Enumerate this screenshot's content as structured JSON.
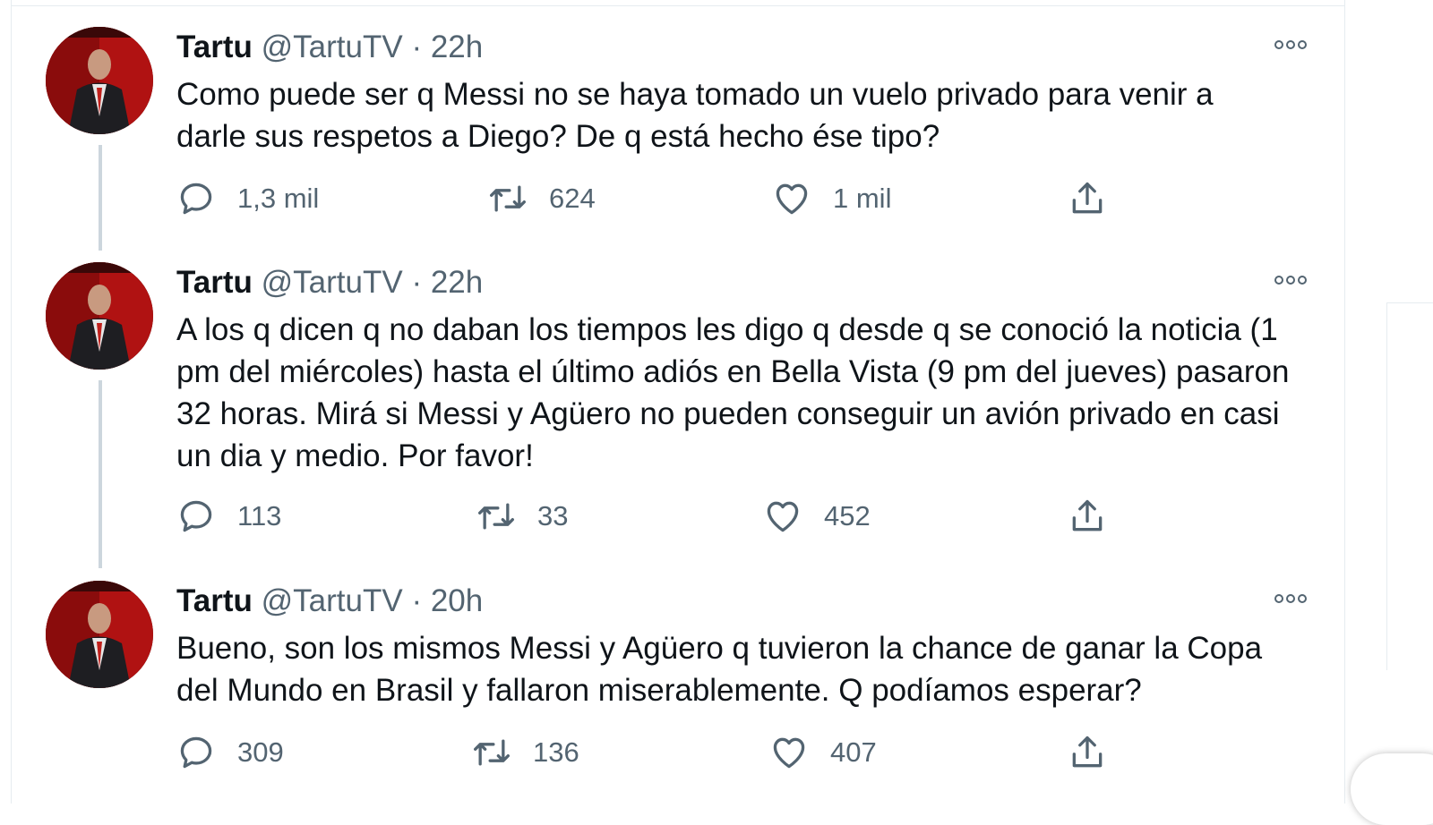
{
  "tweets": [
    {
      "name": "Tartu",
      "handle": "@TartuTV",
      "separator": "·",
      "time": "22h",
      "text": "Como puede ser q Messi no se haya tomado un vuelo privado para venir a darle sus respetos a Diego? De q está hecho ése tipo?",
      "replies": "1,3 mil",
      "retweets": "624",
      "likes": "1 mil"
    },
    {
      "name": "Tartu",
      "handle": "@TartuTV",
      "separator": "·",
      "time": "22h",
      "text": "A los q dicen q no daban los tiempos les digo q desde q se conoció la noticia (1 pm del miércoles) hasta el último adiós en Bella  Vista (9 pm del jueves) pasaron 32 horas. Mirá si Messi y Agüero no pueden conseguir un avión privado en casi un dia y medio. Por favor!",
      "replies": "113",
      "retweets": "33",
      "likes": "452"
    },
    {
      "name": "Tartu",
      "handle": "@TartuTV",
      "separator": "·",
      "time": "20h",
      "text": "Bueno, son los mismos Messi y Agüero q tuvieron la chance de ganar la Copa del Mundo en Brasil y fallaron miserablemente. Q podíamos esperar?",
      "replies": "309",
      "retweets": "136",
      "likes": "407"
    }
  ],
  "icons": {
    "reply": "reply-icon",
    "retweet": "retweet-icon",
    "like": "heart-icon",
    "share": "share-icon",
    "more": "more-options-icon"
  },
  "colors": {
    "text": "#0f1419",
    "secondary": "#536471",
    "thread_line": "#ccd6dd",
    "border": "#e6ecf0"
  }
}
